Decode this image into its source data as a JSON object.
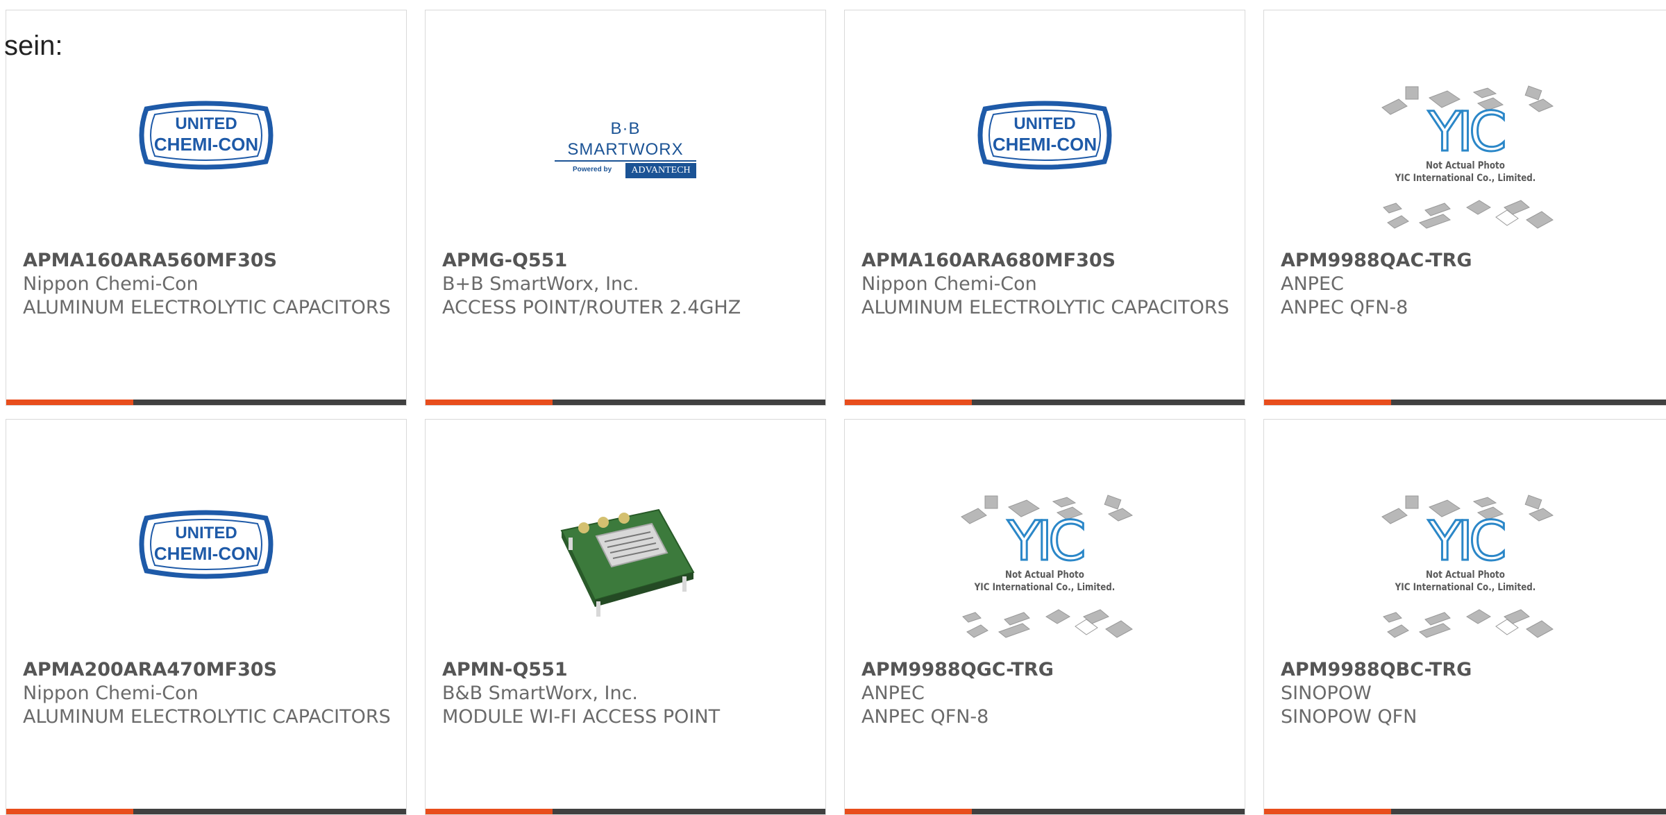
{
  "page_prefix": "sein:",
  "colors": {
    "accent": "#e84d1c",
    "bar": "#404040",
    "ucc_blue": "#1e5aa8",
    "bb_blue": "#1b5395",
    "yic_blue": "#2b87c8"
  },
  "logos": {
    "ucc": {
      "line1": "UNITED",
      "line2": "CHEMI-CON"
    },
    "bb": {
      "top": "B·B SMARTWORX",
      "powered": "Powered by",
      "advantech": "ADVANTECH"
    },
    "yic": {
      "mark": "YIC",
      "line1": "Not Actual Photo",
      "line2": "YIC International Co., Limited."
    }
  },
  "products": [
    {
      "part": "APMA160ARA560MF30S",
      "manufacturer": "Nippon Chemi-Con",
      "description": "ALUMINUM ELECTROLYTIC CAPACITORS",
      "image": "united-chemi-con-logo"
    },
    {
      "part": "APMG-Q551",
      "manufacturer": "B+B SmartWorx, Inc.",
      "description": "ACCESS POINT/ROUTER 2.4GHZ",
      "image": "bb-smartworx-logo"
    },
    {
      "part": "APMA160ARA680MF30S",
      "manufacturer": "Nippon Chemi-Con",
      "description": "ALUMINUM ELECTROLYTIC CAPACITORS",
      "image": "united-chemi-con-logo"
    },
    {
      "part": "APM9988QAC-TRG",
      "manufacturer": "ANPEC",
      "description": "ANPEC QFN-8",
      "image": "yic-not-actual-photo"
    },
    {
      "part": "APMA200ARA470MF30S",
      "manufacturer": "Nippon Chemi-Con",
      "description": "ALUMINUM ELECTROLYTIC CAPACITORS",
      "image": "united-chemi-con-logo"
    },
    {
      "part": "APMN-Q551",
      "manufacturer": "B&B SmartWorx, Inc.",
      "description": "MODULE WI-FI ACCESS POINT",
      "image": "wifi-module-photo"
    },
    {
      "part": "APM9988QGC-TRG",
      "manufacturer": "ANPEC",
      "description": "ANPEC QFN-8",
      "image": "yic-not-actual-photo"
    },
    {
      "part": "APM9988QBC-TRG",
      "manufacturer": "SINOPOW",
      "description": "SINOPOW QFN",
      "image": "yic-not-actual-photo"
    }
  ]
}
